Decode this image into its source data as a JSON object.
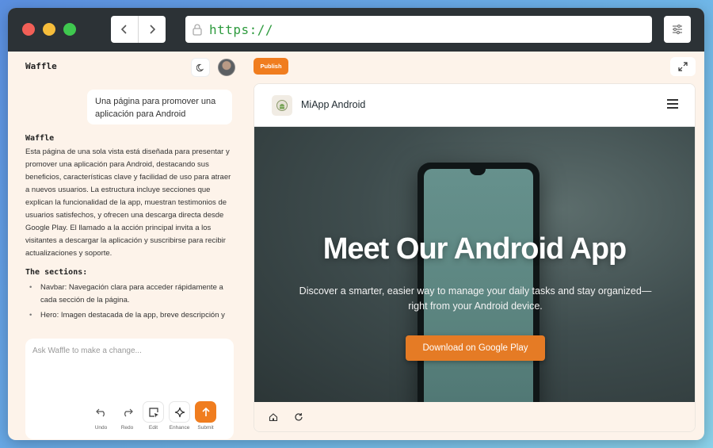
{
  "browser": {
    "url": "https://",
    "back_icon": "chevron-left-icon",
    "forward_icon": "chevron-right-icon",
    "lock_icon": "lock-icon",
    "settings_icon": "sliders-icon"
  },
  "sidebar": {
    "brand": "Waffle",
    "theme_icon": "moon-icon",
    "user_message": "Una página para promover una aplicación para Android",
    "response": {
      "title": "Waffle",
      "body": "Esta página de una sola vista está diseñada para presentar y promover una aplicación para Android, destacando sus beneficios, características clave y facilidad de uso para atraer a nuevos usuarios. La estructura incluye secciones que explican la funcionalidad de la app, muestran testimonios de usuarios satisfechos, y ofrecen una descarga directa desde Google Play. El llamado a la acción principal invita a los visitantes a descargar la aplicación y suscribirse para recibir actualizaciones y soporte.",
      "sections_title": "The sections:",
      "sections": [
        "Navbar: Navegación clara para acceder rápidamente a cada sección de la página.",
        "Hero: Imagen destacada de la app, breve descripción y"
      ]
    },
    "composer": {
      "placeholder": "Ask Waffle to make a change...",
      "tools": [
        {
          "label": "Undo",
          "icon": "undo-icon"
        },
        {
          "label": "Redo",
          "icon": "redo-icon"
        },
        {
          "label": "Edit",
          "icon": "edit-select-icon"
        },
        {
          "label": "Enhance",
          "icon": "sparkle-icon"
        },
        {
          "label": "Submit",
          "icon": "arrow-up-icon"
        }
      ]
    }
  },
  "toolbar": {
    "publish_label": "Publish",
    "expand_icon": "expand-icon"
  },
  "preview": {
    "app_name": "MiApp Android",
    "menu_icon": "hamburger-menu-icon",
    "hero_title": "Meet Our Android App",
    "hero_subtitle": "Discover a smarter, easier way to manage your daily tasks and stay organized—right from your Android device.",
    "cta_label": "Download on Google Play",
    "footer_icons": [
      "home-icon",
      "refresh-icon"
    ]
  },
  "colors": {
    "accent": "#f07d1f",
    "url_text": "#2e9b3e",
    "titlebar": "#2c3236",
    "panel_bg": "#fdf3ea"
  }
}
